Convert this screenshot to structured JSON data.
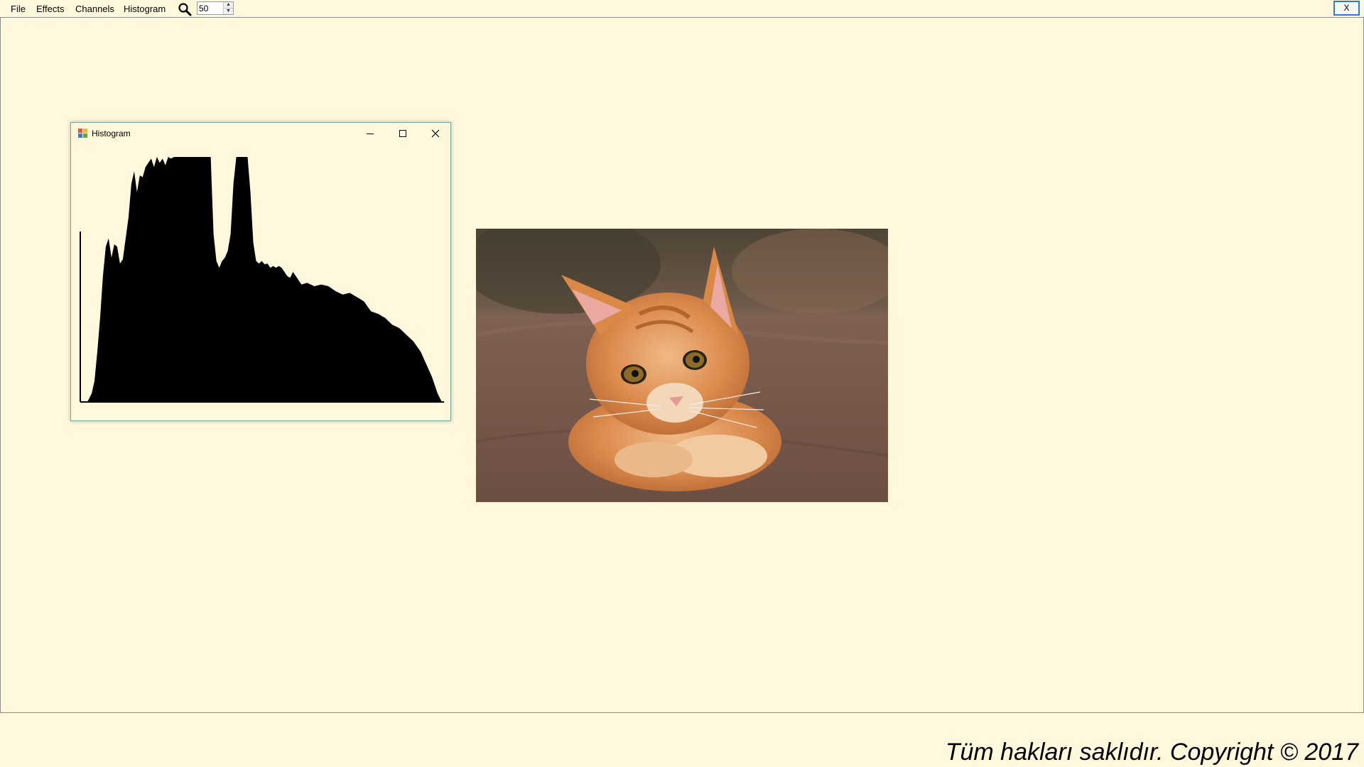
{
  "menu": {
    "items": [
      "File",
      "Effects",
      "Channels",
      "Histogram"
    ],
    "zoom_value": "50"
  },
  "window_close_label": "X",
  "histogram_window": {
    "title": "Histogram",
    "icon": "app-icon",
    "chart_data": {
      "type": "area",
      "x": [
        0,
        5,
        8,
        10,
        12,
        14,
        16,
        18,
        20,
        22,
        24,
        26,
        28,
        30,
        32,
        34,
        36,
        38,
        40,
        42,
        44,
        46,
        48,
        50,
        52,
        54,
        56,
        58,
        60,
        62,
        64,
        66,
        68,
        70,
        72,
        74,
        76,
        78,
        80,
        82,
        84,
        86,
        88,
        90,
        92,
        94,
        96,
        98,
        100,
        102,
        104,
        106,
        108,
        110,
        112,
        114,
        116,
        118,
        120,
        122,
        124,
        126,
        128,
        130,
        132,
        134,
        136,
        138,
        140,
        142,
        144,
        146,
        148,
        150,
        152,
        154,
        156,
        160,
        165,
        170,
        175,
        180,
        185,
        190,
        195,
        200,
        205,
        210,
        215,
        220,
        225,
        230,
        235,
        240,
        244,
        248,
        252,
        255
      ],
      "values": [
        0,
        0,
        10,
        25,
        60,
        100,
        150,
        185,
        195,
        172,
        188,
        185,
        165,
        170,
        195,
        220,
        260,
        275,
        250,
        270,
        268,
        280,
        285,
        290,
        280,
        292,
        285,
        290,
        282,
        292,
        290,
        292,
        292,
        292,
        292,
        292,
        292,
        292,
        292,
        292,
        292,
        292,
        292,
        292,
        292,
        200,
        168,
        160,
        168,
        172,
        180,
        200,
        260,
        292,
        292,
        292,
        292,
        292,
        250,
        190,
        168,
        165,
        168,
        164,
        165,
        160,
        162,
        160,
        162,
        160,
        155,
        150,
        148,
        155,
        150,
        145,
        140,
        142,
        138,
        140,
        138,
        132,
        128,
        130,
        125,
        120,
        108,
        105,
        100,
        92,
        88,
        80,
        72,
        60,
        45,
        30,
        10,
        0
      ],
      "xlim": [
        0,
        255
      ]
    }
  },
  "image": {
    "subject": "orange-kitten-photo",
    "colors": {
      "background": "#6f5747",
      "fur": "#d98a4a",
      "blanket": "#7a5a4c"
    }
  },
  "footer": "Tüm hakları saklıdır. Copyright © 2017",
  "colors": {
    "app_background": "#fff8dc",
    "accent": "#2b7bd6",
    "window_border": "#6fa9a0"
  }
}
